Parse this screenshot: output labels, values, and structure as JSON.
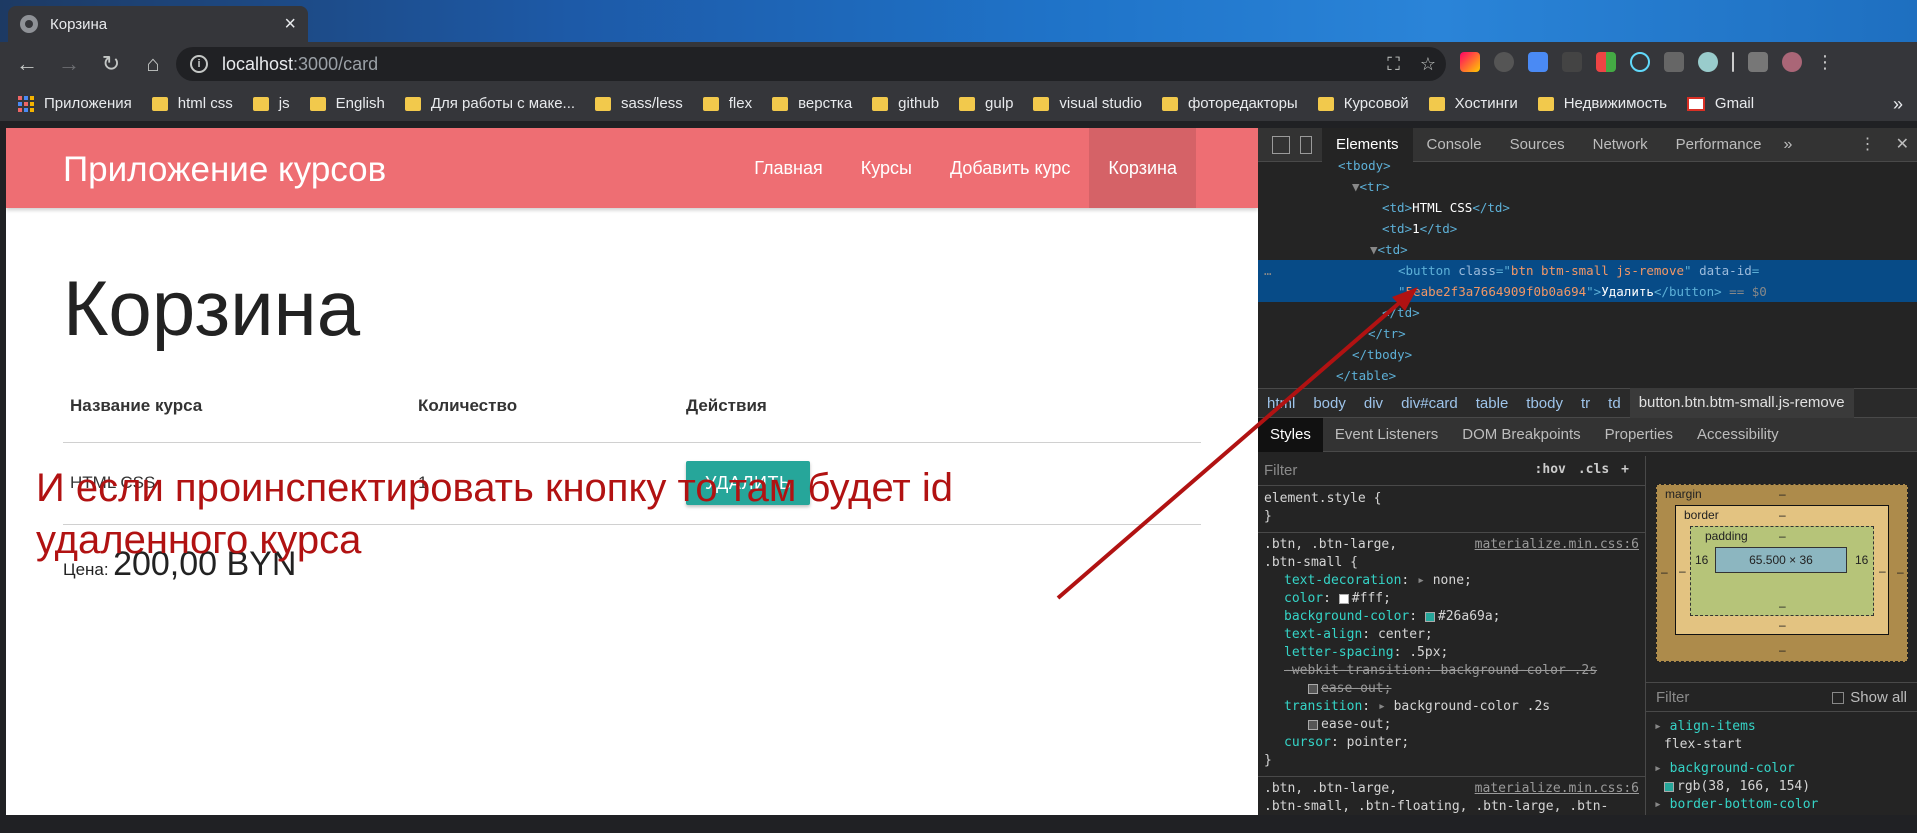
{
  "browser": {
    "tab_title": "Корзина",
    "url_host": "localhost",
    "url_path": ":3000/card",
    "bookmarks": [
      {
        "label": "Приложения",
        "icon": "apps-icon"
      },
      {
        "label": "html css",
        "icon": "folder-icon"
      },
      {
        "label": "js",
        "icon": "folder-icon"
      },
      {
        "label": "English",
        "icon": "folder-icon"
      },
      {
        "label": "Для работы с маке...",
        "icon": "folder-icon"
      },
      {
        "label": "sass/less",
        "icon": "folder-icon"
      },
      {
        "label": "flex",
        "icon": "folder-icon"
      },
      {
        "label": "верстка",
        "icon": "folder-icon"
      },
      {
        "label": "github",
        "icon": "folder-icon"
      },
      {
        "label": "gulp",
        "icon": "folder-icon"
      },
      {
        "label": "visual studio",
        "icon": "folder-icon"
      },
      {
        "label": "фоторедакторы",
        "icon": "folder-icon"
      },
      {
        "label": "Курсовой",
        "icon": "folder-icon"
      },
      {
        "label": "Хостинги",
        "icon": "folder-icon"
      },
      {
        "label": "Недвижимость",
        "icon": "folder-icon"
      },
      {
        "label": "Gmail",
        "icon": "gmail-icon"
      }
    ]
  },
  "site": {
    "brand": "Приложение курсов",
    "nav": [
      "Главная",
      "Курсы",
      "Добавить курс",
      "Корзина"
    ],
    "active_nav": "Корзина",
    "accent": "#ee6e73",
    "button_color": "#26a69a"
  },
  "cart": {
    "title": "Корзина",
    "columns": [
      "Название курса",
      "Количество",
      "Действия"
    ],
    "rows": [
      {
        "name": "HTML CSS",
        "count": "1",
        "action": "УДАЛИТЬ"
      }
    ],
    "price_label": "Цена:",
    "price_value": "200,00 BYN"
  },
  "annotation": {
    "line1": "И если проинспектировать кнопку то там будет id",
    "line2": "удаленного курса",
    "color": "#b11212"
  },
  "devtools": {
    "tabs": [
      "Elements",
      "Console",
      "Sources",
      "Network",
      "Performance"
    ],
    "active_tab": "Elements",
    "dom": {
      "tbody_open": "<tbody>",
      "tr_open": "<tr>",
      "td_name": "HTML CSS",
      "td_count": "1",
      "button_class": "btn btm-small js-remove",
      "button_data_id": "5eabe2f3a7664909f0b0a694",
      "button_text": "Удалить",
      "selected_marker": "== $0"
    },
    "breadcrumbs": [
      "html",
      "body",
      "div",
      "div#card",
      "table",
      "tbody",
      "tr",
      "td",
      "button.btn.btm-small.js-remove"
    ],
    "styles_tabs": [
      "Styles",
      "Event Listeners",
      "DOM Breakpoints",
      "Properties",
      "Accessibility"
    ],
    "filter_placeholder": "Filter",
    "filter_hov": ":hov",
    "filter_cls": ".cls",
    "element_style": "element.style {",
    "rule_source": "materialize.min.css:6",
    "rule_selector_1": ".btn, .btn-large,",
    "rule_selector_2": ".btn-small {",
    "decls": [
      {
        "prop": "text-decoration",
        "value": "none;"
      },
      {
        "prop": "color",
        "value": "#fff;"
      },
      {
        "prop": "background-color",
        "value": "#26a69a;"
      },
      {
        "prop": "text-align",
        "value": "center;"
      },
      {
        "prop": "letter-spacing",
        "value": ".5px;"
      },
      {
        "prop": "-webkit-transition",
        "value": "background-color .2s"
      },
      {
        "prop": "transition",
        "value": "background-color .2s"
      },
      {
        "prop": "cursor",
        "value": "pointer;"
      }
    ],
    "ease_out": "ease-out;",
    "rule2_selector": ".btn, .btn-large,",
    "rule2_selector_b": ".btn-small, .btn-floating, .btn-large, .btn-",
    "box_model": {
      "margin": "margin",
      "border": "border",
      "padding": "padding",
      "dash": "–",
      "content": "65.500 × 36",
      "padding_left": "16",
      "padding_right": "16"
    },
    "computed_filter": "Filter",
    "show_all": "Show all",
    "computed": [
      {
        "prop": "align-items",
        "value": "flex-start"
      },
      {
        "prop": "background-color",
        "value": "rgb(38, 166, 154)"
      },
      {
        "prop": "border-bottom-color",
        "value": ""
      }
    ]
  }
}
